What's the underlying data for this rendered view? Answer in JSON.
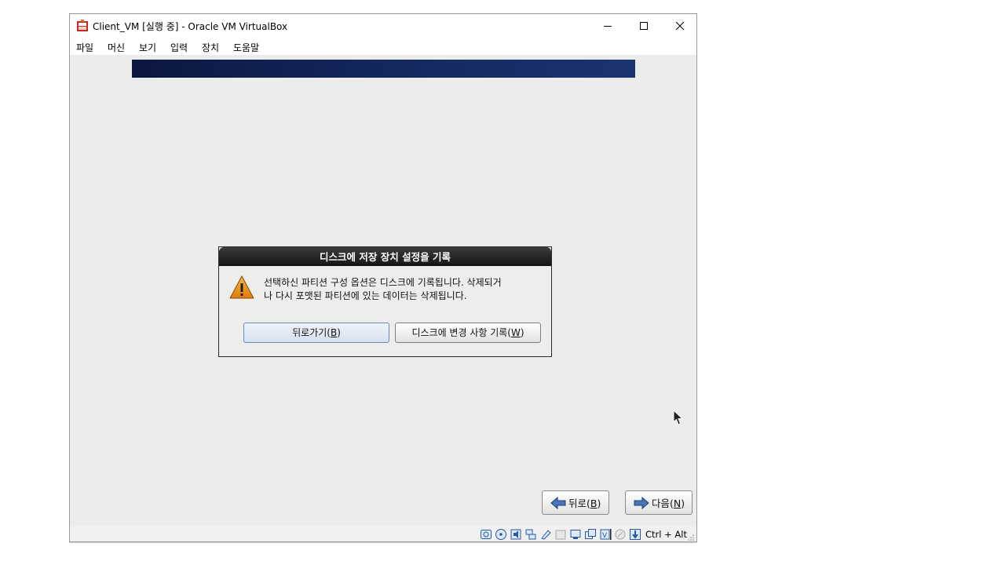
{
  "window": {
    "title": "Client_VM [실행 중] - Oracle VM VirtualBox",
    "controls": [
      "minimize",
      "maximize",
      "close"
    ]
  },
  "menu": {
    "items": [
      "파일",
      "머신",
      "보기",
      "입력",
      "장치",
      "도움말"
    ]
  },
  "dialog": {
    "title": "디스크에 저장 장치 설정을 기록",
    "message_line1": "선택하신 파티션 구성 옵션은 디스크에 기록됩니다. 삭제되거",
    "message_line2": "나 다시 포맷된 파티션에 있는 데이터는 삭제됩니다.",
    "back_button": {
      "prefix": "뒤로가기(",
      "mnemonic": "B",
      "suffix": ")"
    },
    "write_button": {
      "prefix": "디스크에 변경 사항 기록(",
      "mnemonic": "W",
      "suffix": ")"
    }
  },
  "nav": {
    "back": {
      "prefix": "뒤로(",
      "mnemonic": "B",
      "suffix": ")"
    },
    "next": {
      "prefix": "다음(",
      "mnemonic": "N",
      "suffix": ")"
    }
  },
  "statusbar": {
    "icons": [
      "hard-disk-icon",
      "optical-drive-icon",
      "audio-icon",
      "network-icon",
      "usb-icon",
      "shared-folders-icon",
      "display-icon",
      "video-capture-icon",
      "cpu-virtualization-icon",
      "mouse-integration-icon",
      "keyboard-capture-icon"
    ],
    "host_key": "Ctrl + Alt"
  },
  "colors": {
    "vm_background": "#ececeb",
    "dialog_title_bar": "#1e1e1e",
    "banner": "#12265a",
    "warning": "#f0a020"
  }
}
